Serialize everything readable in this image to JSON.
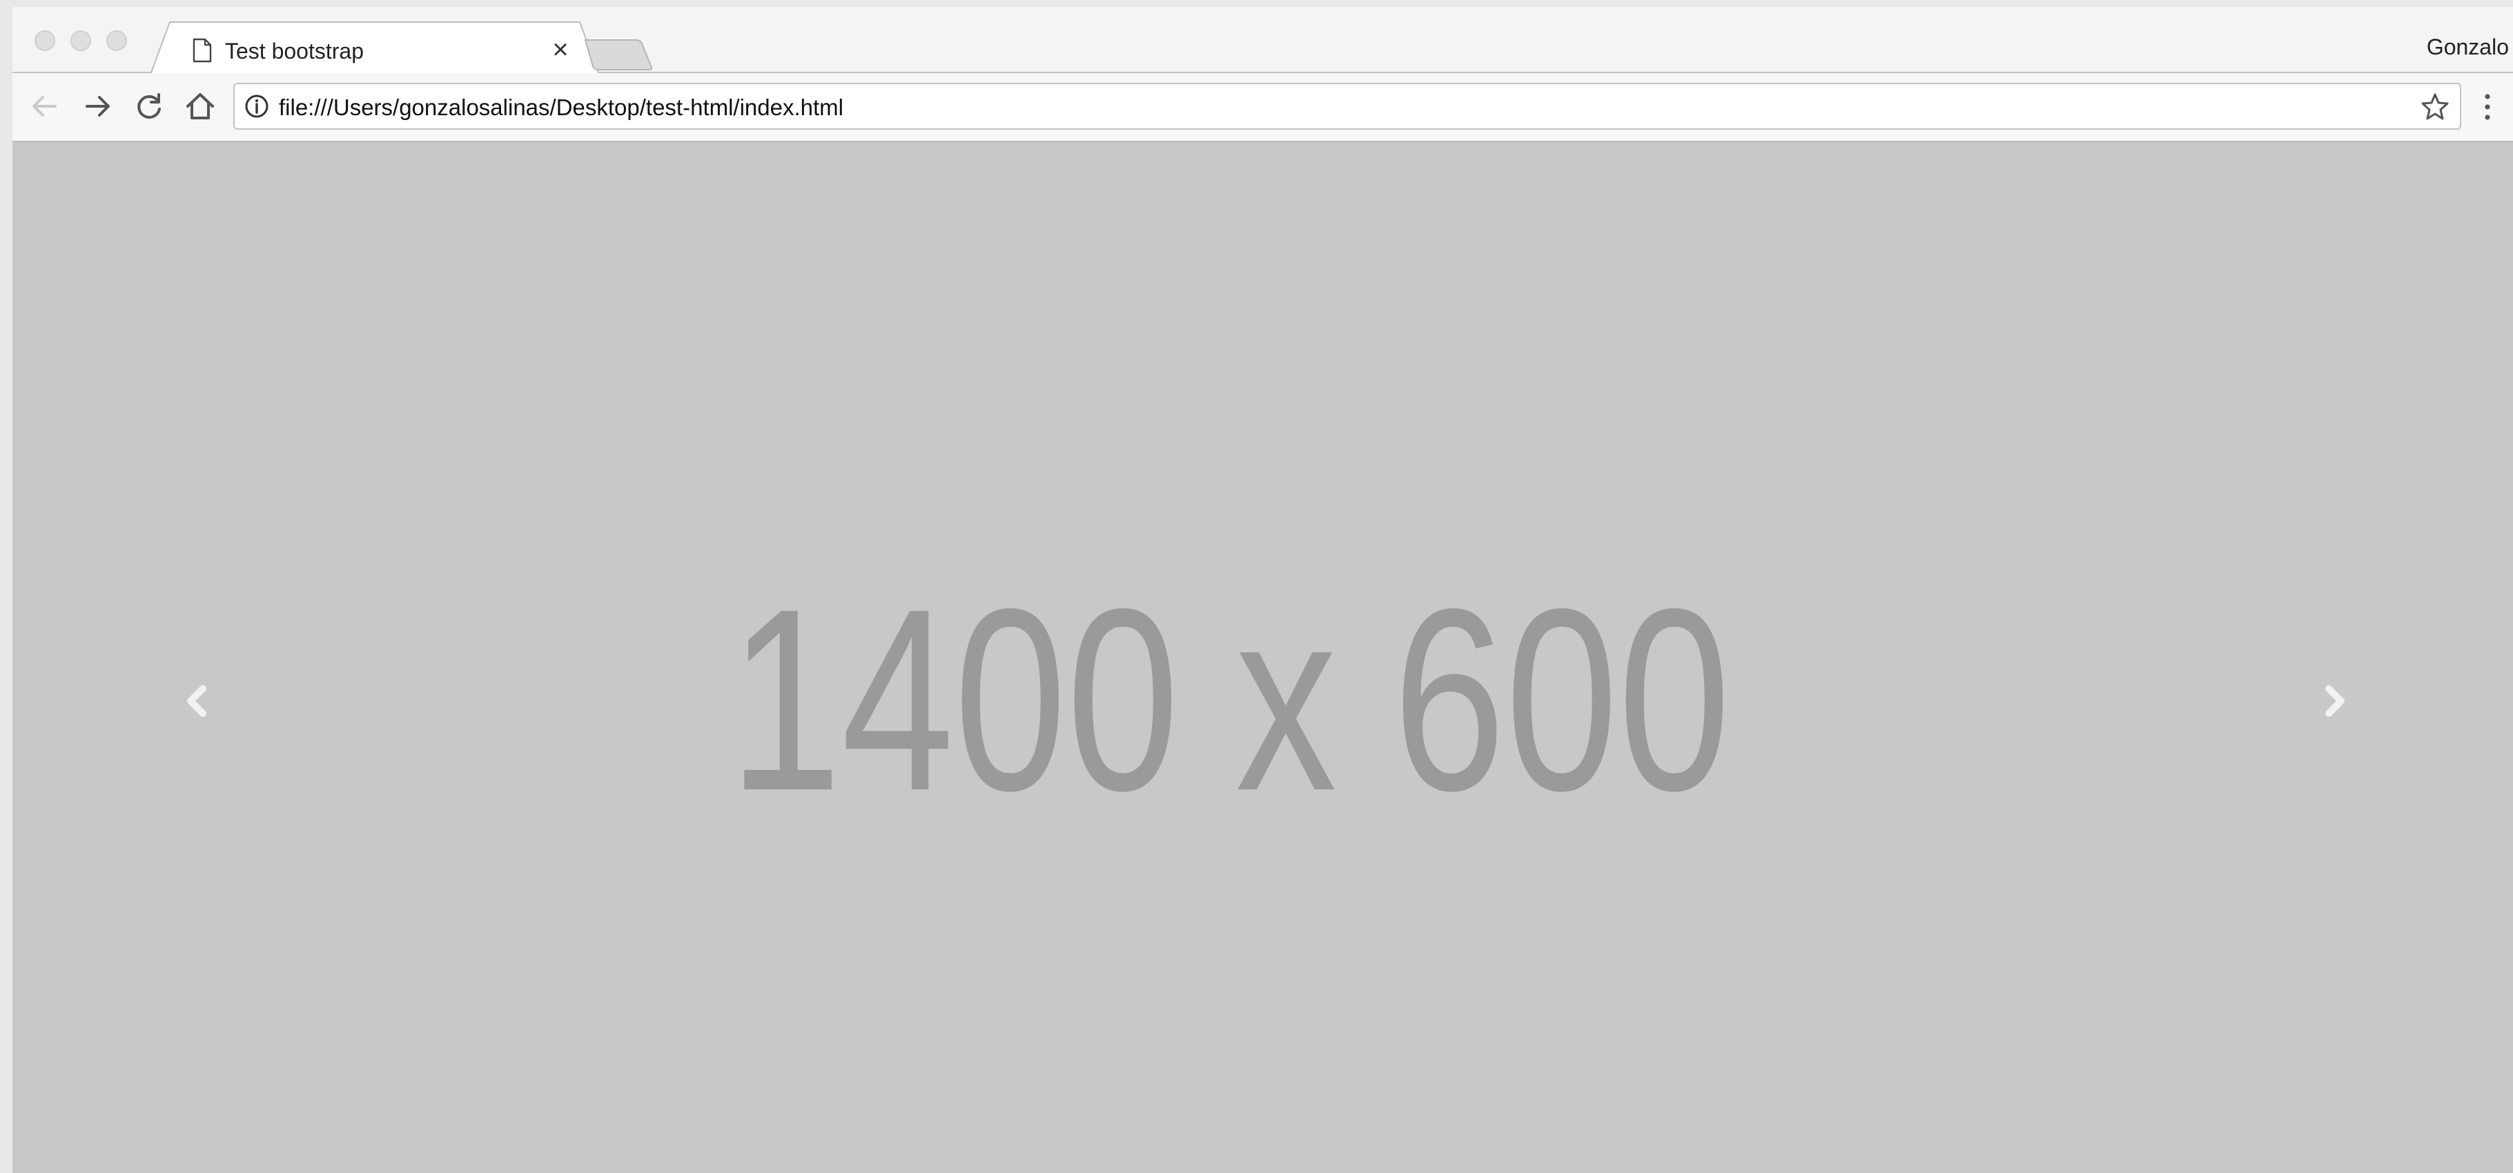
{
  "window": {
    "traffic_lights": [
      "close",
      "minimize",
      "maximize"
    ]
  },
  "tabs": [
    {
      "title": "Test bootstrap",
      "icon": "document-icon",
      "close_glyph": "×"
    }
  ],
  "profile": {
    "name": "Gonzalo"
  },
  "toolbar": {
    "back_icon": "arrow-left-icon",
    "forward_icon": "arrow-right-icon",
    "reload_icon": "reload-icon",
    "home_icon": "home-icon",
    "url": "file:///Users/gonzalosalinas/Desktop/test-html/index.html",
    "info_icon": "info-icon",
    "bookmark_icon": "star-icon",
    "menu_icon": "kebab-menu-icon"
  },
  "carousel": {
    "placeholder_text": "1400 x 600",
    "prev_icon": "chevron-left-icon",
    "next_icon": "chevron-right-icon"
  },
  "colors": {
    "content_background": "#c8c8c8",
    "placeholder_text": "#9a9a9a",
    "carousel_arrows": "#f0f0f0",
    "toolbar_background": "#f7f7f7"
  }
}
